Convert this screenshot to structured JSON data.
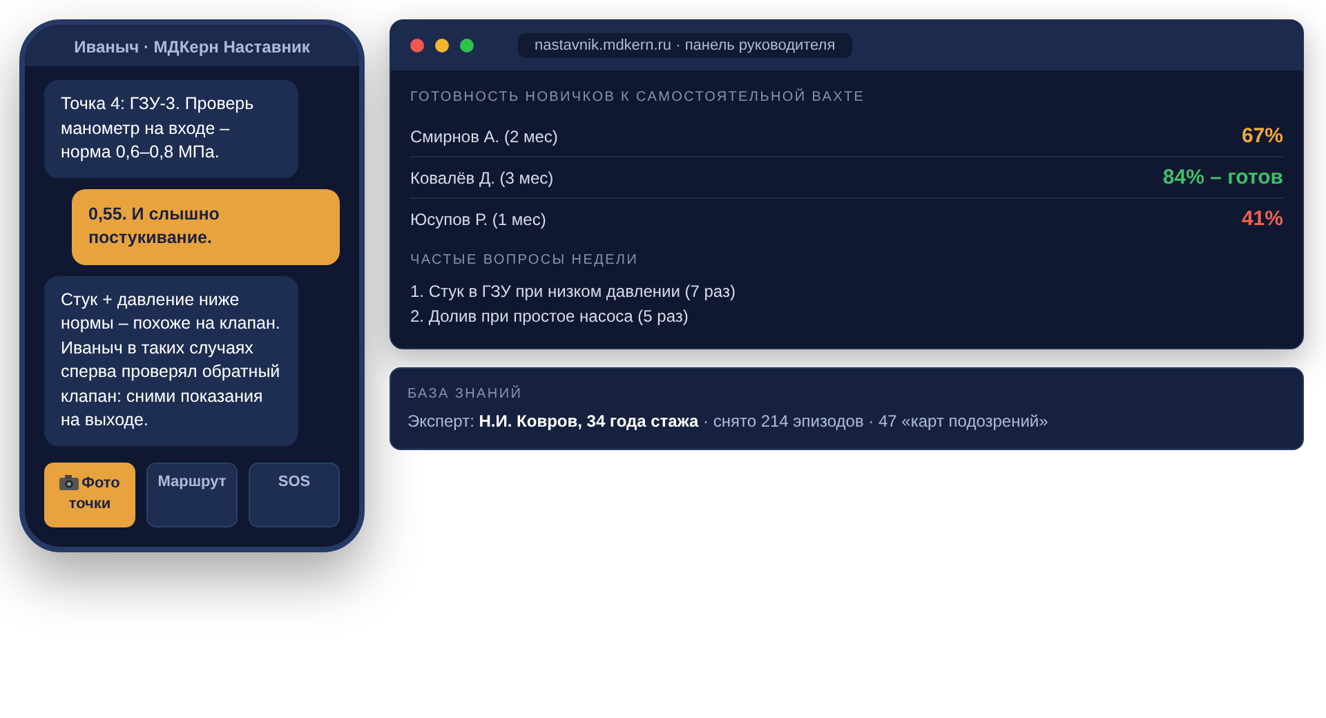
{
  "phone": {
    "title": "Иваныч · МДКерн Наставник",
    "messages": [
      {
        "kind": "bot",
        "text": "Точка 4: ГЗУ-3. Проверь манометр на входе – норма 0,6–0,8 МПа."
      },
      {
        "kind": "user",
        "text": "0,55. И слышно постукивание."
      },
      {
        "kind": "bot",
        "text": "Стук + давление ниже нормы – похоже на клапан. Иваныч в таких случаях сперва проверял обратный клапан: сними показания на выходе."
      }
    ],
    "buttons": [
      {
        "label": "Фото точки",
        "kind": "photo",
        "selected": true
      },
      {
        "label": "Маршрут",
        "kind": "plain",
        "selected": false
      },
      {
        "label": "SOS",
        "kind": "plain",
        "selected": false
      }
    ]
  },
  "dashboard": {
    "address": "nastavnik.mdkern.ru · панель руководителя",
    "readiness_title": "ГОТОВНОСТЬ НОВИЧКОВ К САМОСТОЯТЕЛЬНОЙ ВАХТЕ",
    "trainees": [
      {
        "name": "Смирнов А. (2 мес)",
        "value": "67%",
        "color": "#f0a93a"
      },
      {
        "name": "Ковалёв Д. (3 мес)",
        "value": "84% – готов",
        "color": "#3fbf6a"
      },
      {
        "name": "Юсупов Р. (1 мес)",
        "value": "41%",
        "color": "#f0614f"
      }
    ],
    "questions_title": "ЧАСТЫЕ ВОПРОСЫ НЕДЕЛИ",
    "questions": [
      "1. Стук в ГЗУ при низком давлении (7 раз)",
      "2. Долив при простое насоса (5 раз)"
    ]
  },
  "knowledge_base": {
    "title": "БАЗА ЗНАНИЙ",
    "text": "Эксперт: **Н.И. Ковров, 34 года стажа** · снято 214 эпизодов · 47 «карт подозрений»"
  }
}
